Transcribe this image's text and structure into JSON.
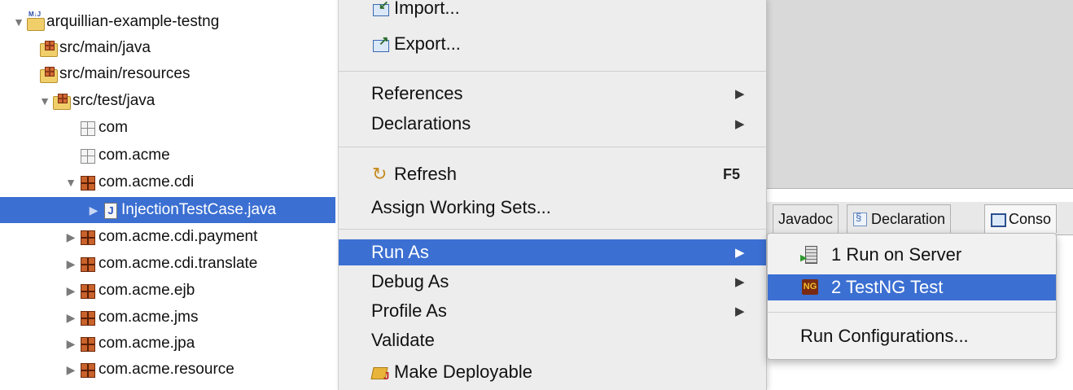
{
  "tree": {
    "items": [
      {
        "label": "arquillian-example-testng",
        "icon": "project-icon",
        "twisty": "▼"
      },
      {
        "label": "src/main/java",
        "icon": "source-folder-icon",
        "twisty": ""
      },
      {
        "label": "src/main/resources",
        "icon": "source-folder-icon",
        "twisty": ""
      },
      {
        "label": "src/test/java",
        "icon": "source-folder-icon",
        "twisty": "▼"
      },
      {
        "label": "com",
        "icon": "empty-package-icon",
        "twisty": ""
      },
      {
        "label": "com.acme",
        "icon": "empty-package-icon",
        "twisty": ""
      },
      {
        "label": "com.acme.cdi",
        "icon": "package-icon",
        "twisty": "▼"
      },
      {
        "label": "InjectionTestCase.java",
        "icon": "java-file-icon",
        "twisty": "▶"
      },
      {
        "label": "com.acme.cdi.payment",
        "icon": "package-icon",
        "twisty": "▶"
      },
      {
        "label": "com.acme.cdi.translate",
        "icon": "package-icon",
        "twisty": "▶"
      },
      {
        "label": "com.acme.ejb",
        "icon": "package-icon",
        "twisty": "▶"
      },
      {
        "label": "com.acme.jms",
        "icon": "package-icon",
        "twisty": "▶"
      },
      {
        "label": "com.acme.jpa",
        "icon": "package-icon",
        "twisty": "▶"
      },
      {
        "label": "com.acme.resource",
        "icon": "package-icon",
        "twisty": "▶"
      }
    ],
    "selected_index": 7
  },
  "menu": {
    "import_label": "Import...",
    "export_label": "Export...",
    "references_label": "References",
    "declarations_label": "Declarations",
    "refresh_label": "Refresh",
    "refresh_shortcut": "F5",
    "assign_working_sets_label": "Assign Working Sets...",
    "run_as_label": "Run As",
    "debug_as_label": "Debug As",
    "profile_as_label": "Profile As",
    "validate_label": "Validate",
    "make_deployable_label": "Make Deployable",
    "submenu_arrow": "▶"
  },
  "submenu": {
    "run_on_server_label": "1 Run on Server",
    "testng_test_label": "2 TestNG Test",
    "run_configurations_label": "Run Configurations..."
  },
  "views": {
    "javadoc_tab": "Javadoc",
    "declaration_tab": "Declaration",
    "console_tab": "Conso"
  },
  "colors": {
    "selection": "#3b6fd2",
    "menu_background": "#ededed"
  }
}
